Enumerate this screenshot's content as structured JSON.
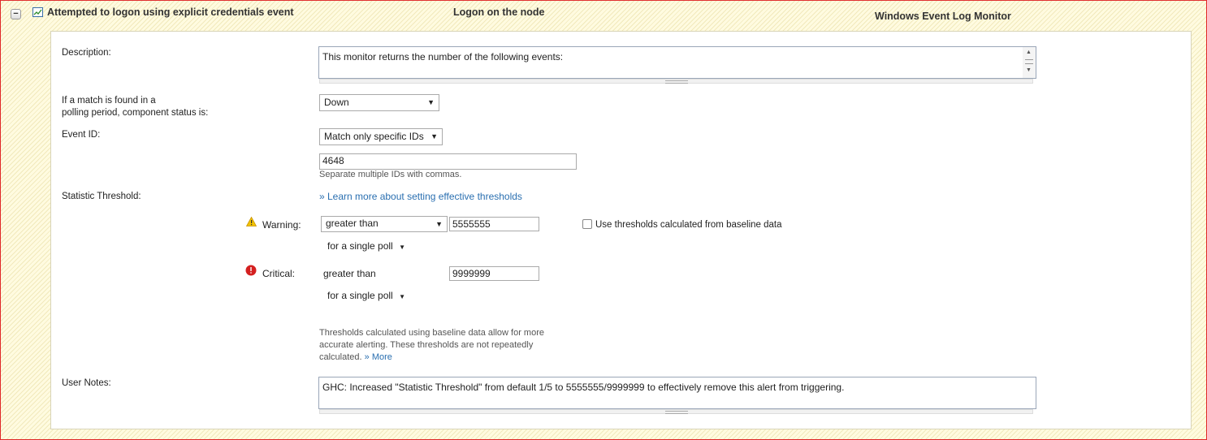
{
  "header": {
    "component_name": "Attempted to logon using explicit credentials event",
    "description_short": "Logon on the node",
    "monitor_type": "Windows Event Log Monitor"
  },
  "form": {
    "description_label": "Description:",
    "description_value": "This monitor returns the number of the following events:",
    "match_status_label_line1": "If a match is found in a",
    "match_status_label_line2": "polling period, component status is:",
    "match_status_value": "Down",
    "event_id_label": "Event ID:",
    "event_id_mode": "Match only specific IDs",
    "event_id_value": "4648",
    "event_id_hint": "Separate multiple IDs with commas.",
    "threshold_label": "Statistic Threshold:",
    "threshold_link": "» Learn more about setting effective thresholds",
    "warning_label": "Warning:",
    "warning_operator": "greater than",
    "warning_value": "5555555",
    "warning_poll": "for  a single poll",
    "baseline_checkbox_label": "Use thresholds calculated from baseline data",
    "baseline_checked": false,
    "critical_label": "Critical:",
    "critical_operator": "greater than",
    "critical_value": "9999999",
    "critical_poll": "for  a single poll",
    "baseline_note_line1": "Thresholds calculated using baseline data allow for more",
    "baseline_note_line2": "accurate alerting. These thresholds are not repeatedly",
    "baseline_note_line3": "calculated.",
    "baseline_more_link": "» More",
    "user_notes_label": "User Notes:",
    "user_notes_value": "GHC: Increased \"Statistic Threshold\" from default 1/5 to 5555555/9999999 to effectively remove this alert from triggering."
  },
  "colors": {
    "frame_border": "#e02828",
    "link": "#2a6fb0",
    "warning": "#f2c200",
    "critical": "#d42020"
  },
  "icons": {
    "collapse": "minus-icon",
    "component": "chart-icon",
    "warning": "warning-triangle-icon",
    "critical": "error-circle-icon"
  }
}
